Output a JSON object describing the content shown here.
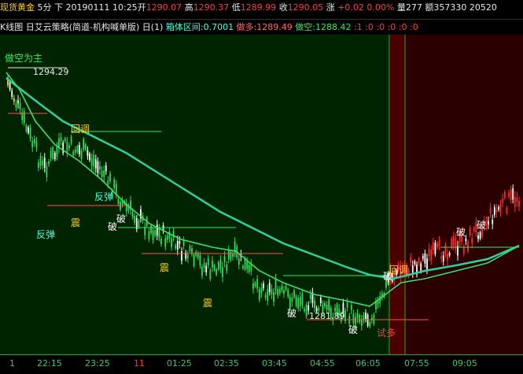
{
  "topbar": {
    "name": "现货黄金",
    "period": "5分",
    "dir": "下",
    "datetime": "20190111 10:25",
    "open_label": "开",
    "open": "1290.07",
    "high_label": "高",
    "high": "1290.37",
    "low_label": "低",
    "low": "1289.99",
    "close_label": "收",
    "close": "1290.05",
    "change_label": "涨",
    "change": "+0.02",
    "change_pct": "0.00%",
    "vol_label": "量",
    "vol": "277",
    "amount_label": "额",
    "amount": "357330",
    "extra": "20520"
  },
  "subbar": {
    "title": "K线图",
    "strategy": "日艾云策略(简道-机构喊单版)",
    "period": "日(1)",
    "box_label": "箱体区间:0.7001",
    "long_label": "做多:1289.49",
    "short_label": "做空:1288.42",
    "flags": ":1 :0 :0 :0 :0 :0"
  },
  "annotations": {
    "short_main": "做空为主",
    "price_high": "1294.29",
    "price_low": "1281.89",
    "pullback1": "回调",
    "pullback2": "回调",
    "rebound1": "反弹",
    "rebound2": "反弹",
    "shake1": "震",
    "shake2": "震",
    "shake3": "震",
    "break": "破",
    "try_long": "试多"
  },
  "xaxis": {
    "labels": [
      "1",
      "22:15",
      "23:25",
      "11",
      "01:25",
      "02:35",
      "03:45",
      "04:55",
      "06:05",
      "07:55",
      "09:05"
    ]
  },
  "colors": {
    "bg_left": "#002400",
    "bg_right": "#2a0000",
    "bg_mid": "#4a0000",
    "ma_green": "#2fd0a0",
    "ma_red": "#ff6060",
    "candle_up": "#ff2a2a",
    "candle_down": "#2edc5a",
    "candle_white": "#ffffff"
  }
}
